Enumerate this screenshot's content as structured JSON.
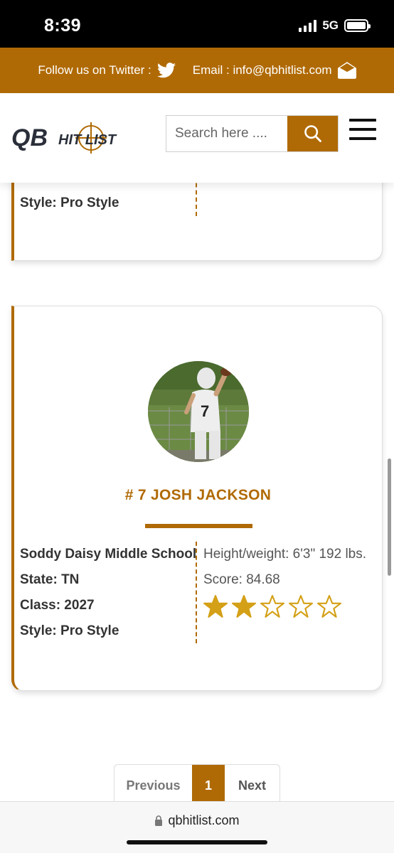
{
  "status": {
    "time": "8:39",
    "network": "5G"
  },
  "topbar": {
    "twitter_text": "Follow us on Twitter :",
    "email_text": "Email : info@qbhitlist.com"
  },
  "header": {
    "logo_text": "QB HIT LIST",
    "search_placeholder": "Search here ...."
  },
  "previous_card": {
    "style": "Style: Pro Style"
  },
  "player": {
    "name": "# 7 JOSH JACKSON",
    "school": "Soddy Daisy Middle School",
    "state": "State: TN",
    "class": "Class: 2027",
    "style": "Style: Pro Style",
    "height_weight": "Height/weight: 6'3\" 192 lbs.",
    "score": "Score: 84.68",
    "rating": {
      "filled": 2,
      "total": 5
    }
  },
  "pagination": {
    "previous": "Previous",
    "current": "1",
    "next": "Next"
  },
  "browser": {
    "url": "qbhitlist.com"
  },
  "colors": {
    "accent": "#b06a05",
    "star": "#d4a017"
  }
}
